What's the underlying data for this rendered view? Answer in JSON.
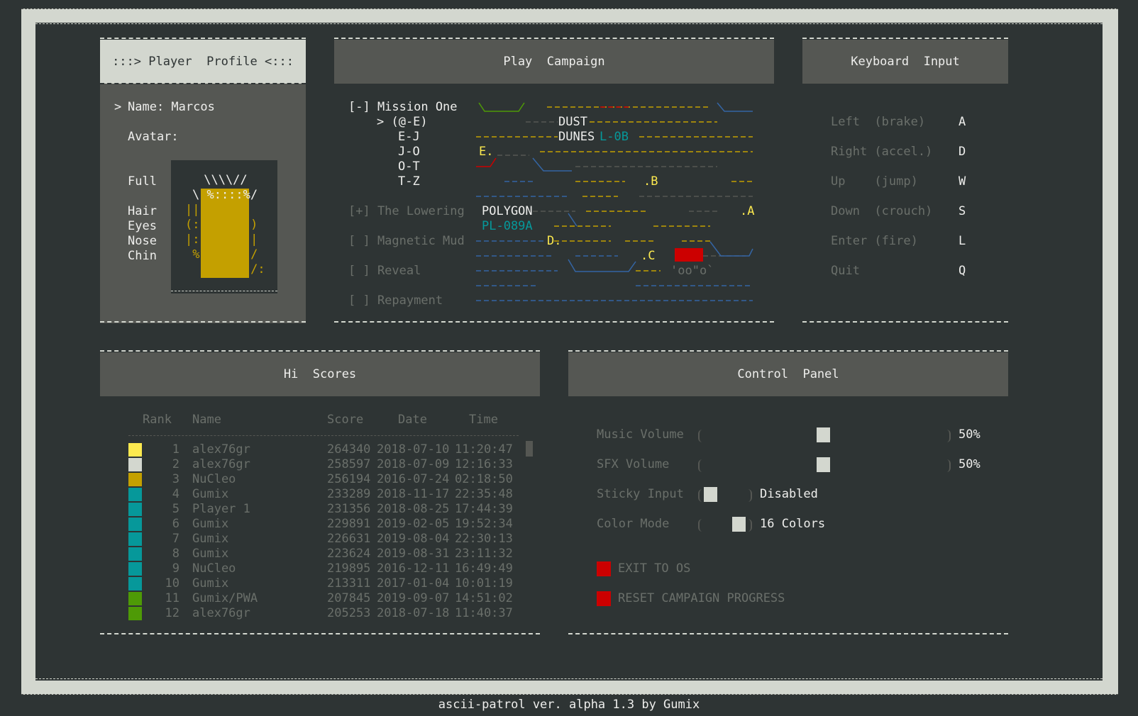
{
  "profile": {
    "title": ":::> Player  Profile <:::",
    "name_cursor": ">",
    "name_label": "Name: Marcos",
    "avatar_label": "Avatar:",
    "parts": [
      "Full",
      "Hair",
      "Eyes",
      "Nose",
      "Chin"
    ],
    "avatar_lines": [
      " \\\\\\\\//",
      "\\ %::::%/",
      "|| __ __|",
      "(:   ,  ,)",
      "|:   .  :|",
      " %:: \\_/:/",
      "  |\\:...:/:"
    ]
  },
  "campaign": {
    "title": "Play  Campaign",
    "missions": [
      {
        "label": "[-] Mission One",
        "active": true
      },
      {
        "label": "[+] The Lowering",
        "active": false
      },
      {
        "label": "[ ] Magnetic Mud",
        "active": false
      },
      {
        "label": "[ ] Reveal",
        "active": false
      },
      {
        "label": "[ ] Repayment",
        "active": false
      }
    ],
    "subitems": [
      "> (@-E)",
      "E-J",
      "J-O",
      "O-T",
      "T-Z"
    ],
    "map_labels": [
      "DUST",
      "DUNES",
      "L-0B",
      "E.",
      ".B",
      "POLYGON",
      "PL-089A",
      "D.",
      ".C",
      ".A",
      "'oo\"o`"
    ]
  },
  "keyboard": {
    "title": "Keyboard  Input",
    "bindings": [
      {
        "action": "Left  (brake)",
        "key": "A"
      },
      {
        "action": "Right (accel.)",
        "key": "D"
      },
      {
        "action": "Up    (jump)",
        "key": "W"
      },
      {
        "action": "Down  (crouch)",
        "key": "S"
      },
      {
        "action": "Enter (fire)",
        "key": "L"
      },
      {
        "action": "Quit",
        "key": "Q"
      }
    ]
  },
  "scores": {
    "title": "Hi  Scores",
    "headers": {
      "rank": "Rank",
      "name": "Name",
      "score": "Score",
      "date": "Date",
      "time": "Time"
    },
    "rows": [
      {
        "rank": "1",
        "name": "alex76gr",
        "score": "264340",
        "date": "2018-07-10",
        "time": "11:20:47",
        "color": "#fce94f"
      },
      {
        "rank": "2",
        "name": "alex76gr",
        "score": "258597",
        "date": "2018-07-09",
        "time": "12:16:33",
        "color": "#d3d7cf"
      },
      {
        "rank": "3",
        "name": "NuCleo",
        "score": "256194",
        "date": "2016-07-24",
        "time": "02:18:50",
        "color": "#c4a000"
      },
      {
        "rank": "4",
        "name": "Gumix",
        "score": "233289",
        "date": "2018-11-17",
        "time": "22:35:48",
        "color": "#06989a"
      },
      {
        "rank": "5",
        "name": "Player 1",
        "score": "231356",
        "date": "2018-08-25",
        "time": "17:44:39",
        "color": "#06989a"
      },
      {
        "rank": "6",
        "name": "Gumix",
        "score": "229891",
        "date": "2019-02-05",
        "time": "19:52:34",
        "color": "#06989a"
      },
      {
        "rank": "7",
        "name": "Gumix",
        "score": "226631",
        "date": "2019-08-04",
        "time": "22:30:13",
        "color": "#06989a"
      },
      {
        "rank": "8",
        "name": "Gumix",
        "score": "223624",
        "date": "2019-08-31",
        "time": "23:11:32",
        "color": "#06989a"
      },
      {
        "rank": "9",
        "name": "NuCleo",
        "score": "219895",
        "date": "2016-12-11",
        "time": "16:49:49",
        "color": "#06989a"
      },
      {
        "rank": "10",
        "name": "Gumix",
        "score": "213311",
        "date": "2017-01-04",
        "time": "10:01:19",
        "color": "#06989a"
      },
      {
        "rank": "11",
        "name": "Gumix/PWA",
        "score": "207845",
        "date": "2019-09-07",
        "time": "14:51:02",
        "color": "#4e9a06"
      },
      {
        "rank": "12",
        "name": "alex76gr",
        "score": "205253",
        "date": "2018-07-18",
        "time": "11:40:37",
        "color": "#4e9a06"
      }
    ]
  },
  "control": {
    "title": "Control  Panel",
    "music_label": "Music Volume",
    "music_value": "50%",
    "music_level": 0.5,
    "sfx_label": "SFX Volume",
    "sfx_value": "50%",
    "sfx_level": 0.5,
    "sticky_label": "Sticky Input",
    "sticky_value": "Disabled",
    "color_label": "Color Mode",
    "color_value": "16 Colors",
    "exit_label": "EXIT TO OS",
    "reset_label": "RESET CAMPAIGN PROGRESS"
  },
  "footer": {
    "text": "ascii-patrol ver. alpha 1.3 by Gumix"
  }
}
